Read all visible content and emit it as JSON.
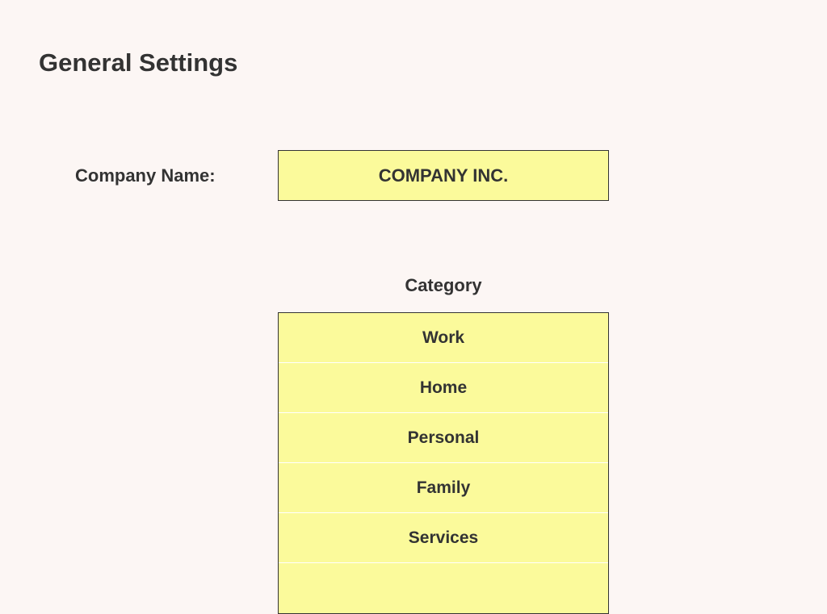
{
  "pageTitle": "General Settings",
  "company": {
    "label": "Company Name:",
    "value": "COMPANY INC."
  },
  "category": {
    "header": "Category",
    "items": [
      "Work",
      "Home",
      "Personal",
      "Family",
      "Services",
      ""
    ]
  }
}
